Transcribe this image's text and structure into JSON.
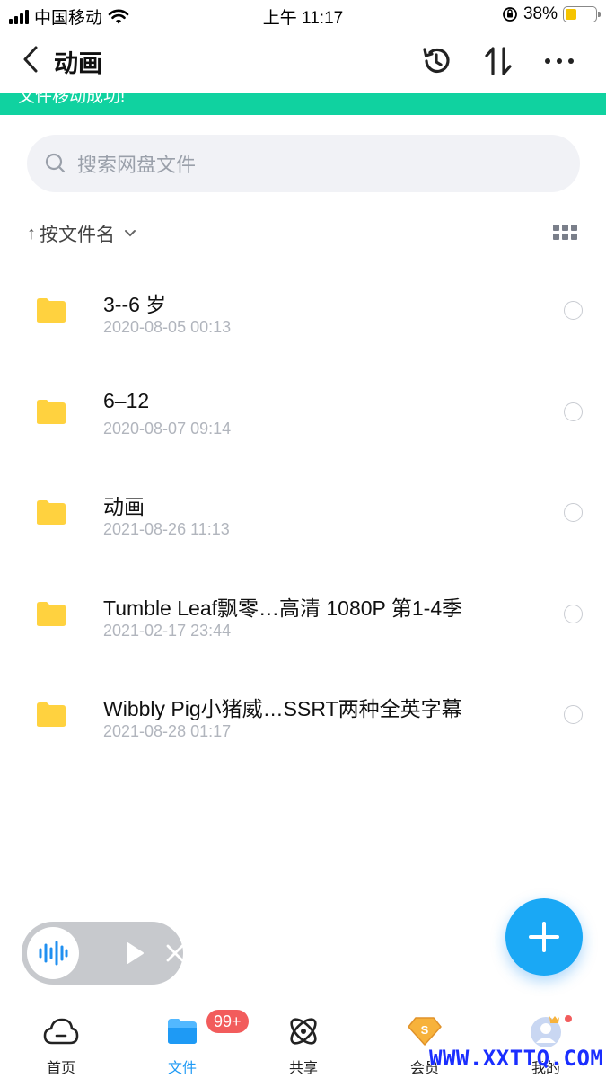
{
  "status_bar": {
    "carrier": "中国移动",
    "time": "上午 11:17",
    "battery_percent": "38%",
    "battery_level": 0.38,
    "battery_color": "#f5c400",
    "icons": [
      "signal-icon",
      "wifi-icon",
      "orientation-lock-icon",
      "battery-icon"
    ]
  },
  "nav": {
    "title": "动画",
    "back_icon": "chevron-left-icon",
    "history_icon": "history-icon",
    "sort_icon": "sort-arrows-icon",
    "more_icon": "more-dots-icon"
  },
  "toast": {
    "text": "文件移动成功!",
    "color": "#10d2a0"
  },
  "search": {
    "placeholder": "搜索网盘文件",
    "icon": "search-icon"
  },
  "sort": {
    "arrow": "↑",
    "label": "按文件名",
    "chevron": "⌄",
    "view_icon": "grid-view-icon"
  },
  "files": [
    {
      "name": "3--6 岁",
      "date": "2020-08-05 00:13"
    },
    {
      "name": "6–12",
      "date": "2020-08-07 09:14"
    },
    {
      "name": "动画",
      "date": "2021-08-26 11:13"
    },
    {
      "name": "Tumble Leaf飘零…高清 1080P 第1-4季",
      "date": "2021-02-17 23:44"
    },
    {
      "name": "Wibbly Pig小猪威…SSRT两种全英字幕",
      "date": "2021-08-28 01:17"
    }
  ],
  "folder_color": "#ffd23f",
  "audio_player": {
    "icons": [
      "audio-wave-icon",
      "play-icon",
      "close-icon"
    ],
    "accent": "#1f8ff0"
  },
  "fab": {
    "icon": "plus-icon",
    "color": "#1aa8f5"
  },
  "tabs": [
    {
      "label": "首页",
      "icon": "cloud-home-icon",
      "active": false
    },
    {
      "label": "文件",
      "icon": "folder-tab-icon",
      "active": true
    },
    {
      "label": "共享",
      "icon": "share-orbit-icon",
      "active": false,
      "badge": "99+"
    },
    {
      "label": "会员",
      "icon": "vip-diamond-icon",
      "active": false
    },
    {
      "label": "我的",
      "icon": "profile-avatar-icon",
      "active": false
    }
  ],
  "tab_active_color": "#1e9af5",
  "badge_color": "#f25c5c",
  "watermark": "WWW.XXTTQ.COM"
}
